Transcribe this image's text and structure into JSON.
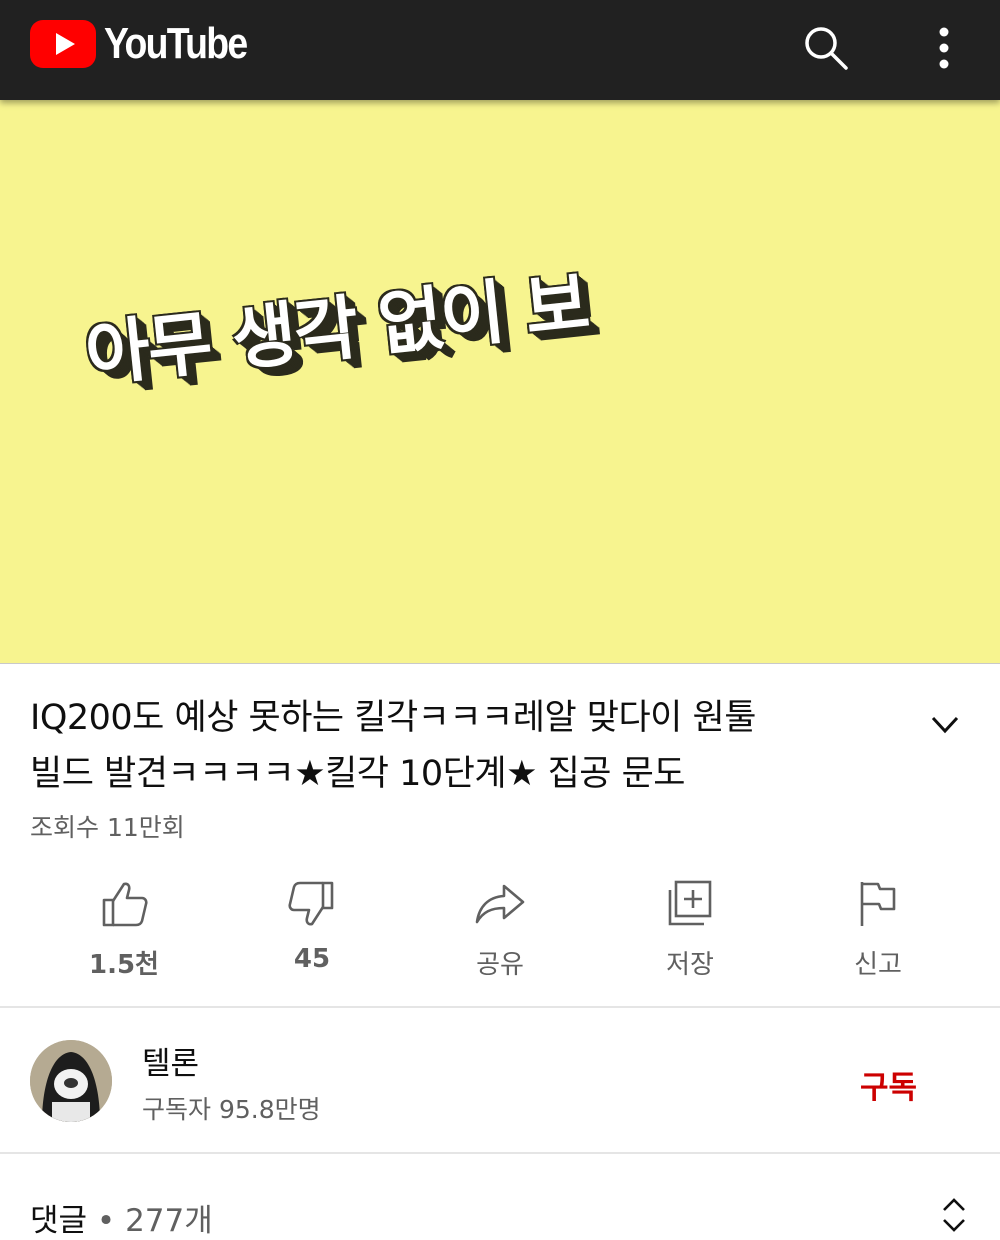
{
  "header": {
    "logo_text": "YouTube",
    "search_icon": "search-icon",
    "menu_icon": "more-vert-icon"
  },
  "video": {
    "caption": "아무 생각 없이 보",
    "background": "#f7f48f"
  },
  "details": {
    "title_line1": "IQ200도 예상 못하는 킬각ㅋㅋㅋ레알 맞다이 원툴",
    "title_line2": "빌드 발견ㅋㅋㅋㅋ★킬각 10단계★ 집공 문도",
    "views": "조회수 11만회"
  },
  "actions": [
    {
      "icon": "thumbs-up-icon",
      "label": "1.5천"
    },
    {
      "icon": "thumbs-down-icon",
      "label": "45"
    },
    {
      "icon": "share-icon",
      "label": "공유"
    },
    {
      "icon": "save-playlist-icon",
      "label": "저장"
    },
    {
      "icon": "flag-icon",
      "label": "신고"
    }
  ],
  "channel": {
    "name": "텔론",
    "subscribers": "구독자 95.8만명",
    "subscribe_label": "구독",
    "subscribe_color": "#cc0000"
  },
  "comments": {
    "label": "댓글",
    "separator": "•",
    "count": "277개"
  }
}
